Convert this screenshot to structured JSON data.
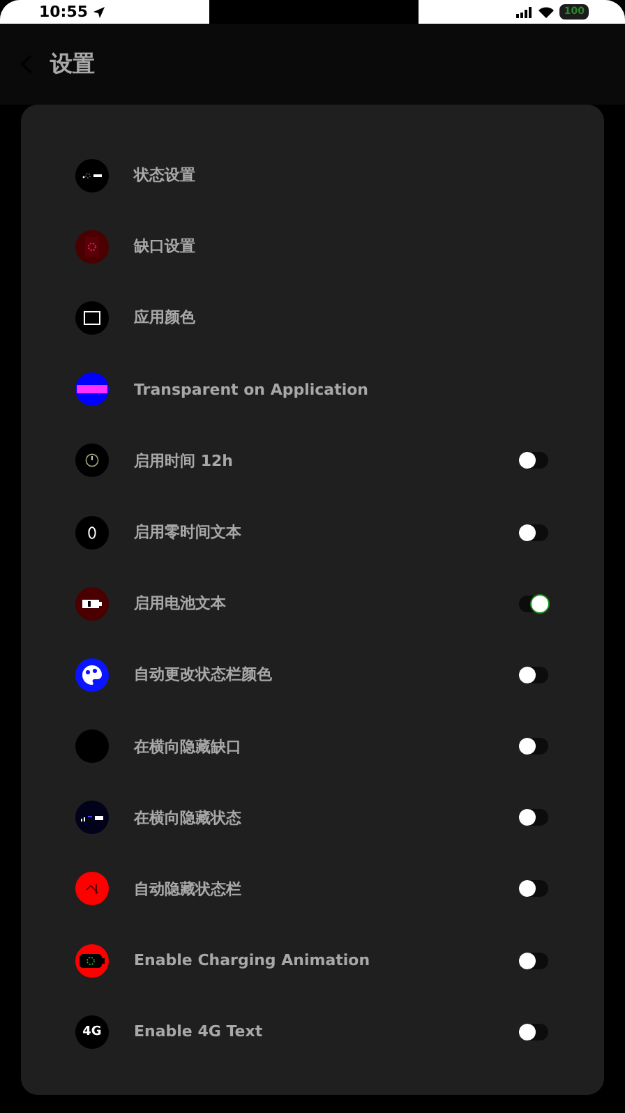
{
  "status_bar": {
    "time": "10:55",
    "battery": "100"
  },
  "header": {
    "title": "设置"
  },
  "items": [
    {
      "label": "状态设置",
      "kind": "link",
      "color": "#000000"
    },
    {
      "label": "缺口设置",
      "kind": "link",
      "color": "#4a0000"
    },
    {
      "label": "应用颜色",
      "kind": "link",
      "color": "#000000"
    },
    {
      "label": "Transparent on Application",
      "kind": "link",
      "color": "#0000ff"
    },
    {
      "label": "启用时间 12h",
      "kind": "toggle",
      "on": false,
      "color": "#000000"
    },
    {
      "label": "启用零时间文本",
      "kind": "toggle",
      "on": false,
      "color": "#000000"
    },
    {
      "label": "启用电池文本",
      "kind": "toggle",
      "on": true,
      "color": "#4a0000"
    },
    {
      "label": "自动更改状态栏颜色",
      "kind": "toggle",
      "on": false,
      "color": "#0a14ff"
    },
    {
      "label": "在横向隐藏缺口",
      "kind": "toggle",
      "on": false,
      "color": "#000000"
    },
    {
      "label": "在横向隐藏状态",
      "kind": "toggle",
      "on": false,
      "color": "#02021a"
    },
    {
      "label": "自动隐藏状态栏",
      "kind": "toggle",
      "on": false,
      "color": "#ff0000"
    },
    {
      "label": "Enable Charging Animation",
      "kind": "toggle",
      "on": false,
      "color": "#ff0000"
    },
    {
      "label": "Enable 4G Text",
      "kind": "toggle",
      "on": false,
      "color": "#000000",
      "badge": "4G"
    }
  ]
}
